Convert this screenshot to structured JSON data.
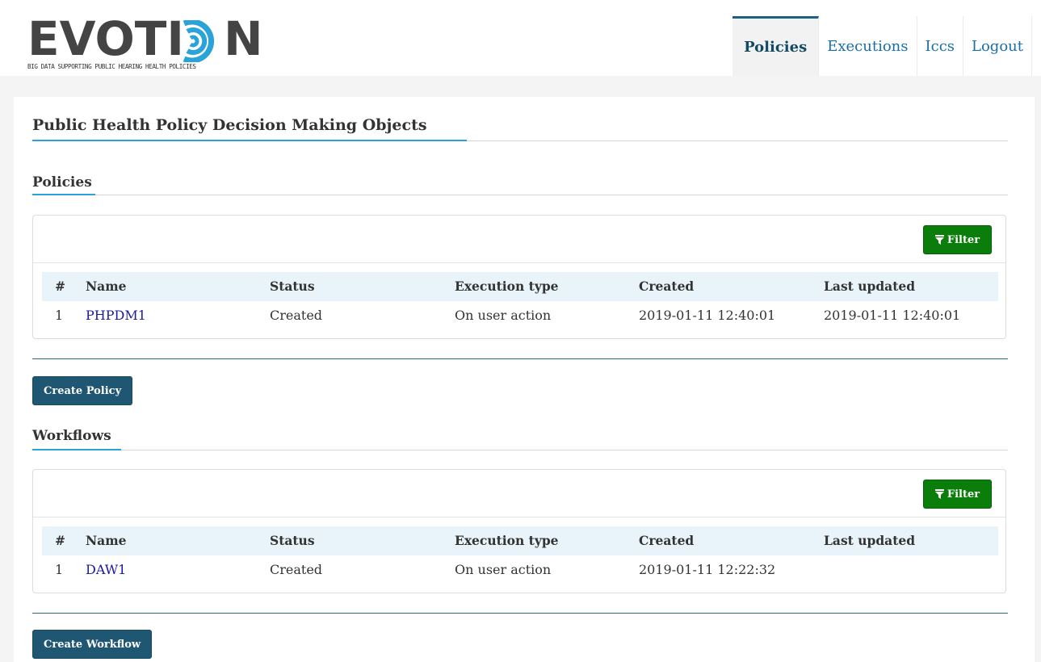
{
  "logo": {
    "word_left": "EVOTI",
    "word_right": "N",
    "tagline": "BIG DATA SUPPORTING PUBLIC HEARING HEALTH POLICIES",
    "colors": {
      "text": "#444444",
      "ring": "#2aa3d8"
    }
  },
  "nav": {
    "items": [
      {
        "label": "Policies",
        "active": true
      },
      {
        "label": "Executions",
        "active": false
      },
      {
        "label": "Iccs",
        "active": false
      },
      {
        "label": "Logout",
        "active": false
      }
    ]
  },
  "page": {
    "title": "Public Health Policy Decision Making Objects"
  },
  "columns": [
    "#",
    "Name",
    "Status",
    "Execution type",
    "Created",
    "Last updated"
  ],
  "policies": {
    "heading": "Policies",
    "filter_label": "Filter",
    "rows": [
      {
        "num": "1",
        "name": "PHPDM1",
        "status": "Created",
        "execution_type": "On user action",
        "created": "2019-01-11 12:40:01",
        "last_updated": "2019-01-11 12:40:01"
      }
    ],
    "create_label": "Create Policy"
  },
  "workflows": {
    "heading": "Workflows",
    "filter_label": "Filter",
    "rows": [
      {
        "num": "1",
        "name": "DAW1",
        "status": "Created",
        "execution_type": "On user action",
        "created": "2019-01-11 12:22:32",
        "last_updated": ""
      }
    ],
    "create_label": "Create Workflow"
  },
  "colors": {
    "accent_blue": "#2aa3d8",
    "nav_active": "#134a66",
    "filter_green": "#0a7d0a",
    "primary_button": "#1f5773",
    "table_header_bg": "#e8f4fa",
    "link": "#1a1a9a"
  }
}
